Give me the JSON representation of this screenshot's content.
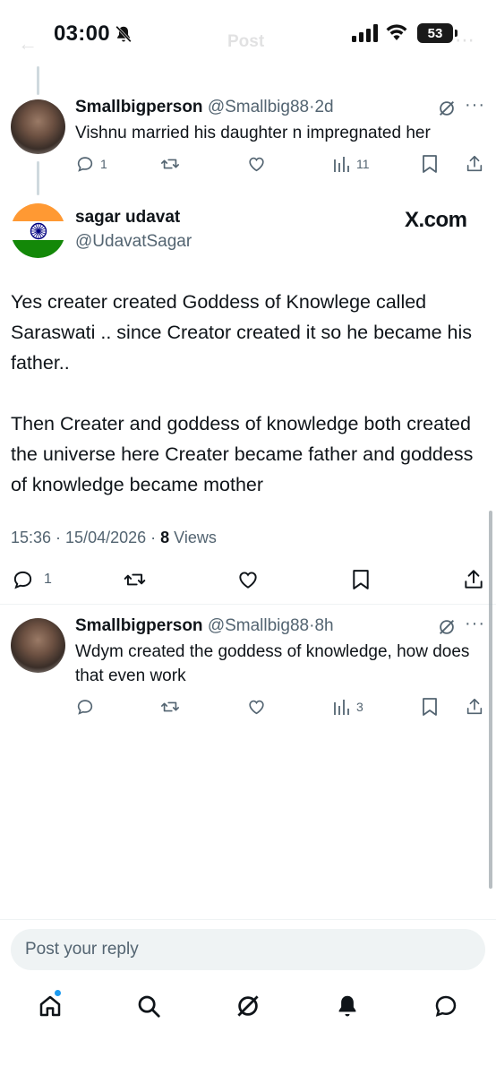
{
  "status_bar": {
    "time": "03:00",
    "battery": "53"
  },
  "header": {
    "title": "Post"
  },
  "parent_reply": {
    "name": "Smallbigperson",
    "handle": "@Smallbig88",
    "separator": "·",
    "time": "2d",
    "text": "Vishnu married his daughter n impregnated her",
    "replies": "1",
    "retweets": "",
    "likes": "",
    "views": "11"
  },
  "main_tweet": {
    "name": "sagar udavat",
    "handle": "@UdavatSagar",
    "source_badge": "X.com",
    "paragraph_1": "Yes creater created Goddess of Knowlege called Saraswati .. since Creator created it so he became his father..",
    "paragraph_2": "Then Creater and goddess of knowledge both created the universe here Creater became father and goddess of knowledge became mother",
    "timestamp": "15:36 · 15/04/2026 · ",
    "views_count": "8",
    "views_label": " Views",
    "replies": "1"
  },
  "reply": {
    "name": "Smallbigperson",
    "handle": "@Smallbig88",
    "separator": "·",
    "time": "8h",
    "text": "Wdym created the goddess of knowledge, how does that even work",
    "views": "3"
  },
  "composer": {
    "placeholder": "Post your reply"
  },
  "bottom_nav": {
    "items": [
      "home-icon",
      "search-icon",
      "grok-icon",
      "notifications-icon",
      "messages-icon"
    ]
  },
  "colors": {
    "text": "#0f1419",
    "muted": "#536471",
    "accent": "#1d9bf0",
    "saffron": "#ff9933",
    "green": "#138808"
  }
}
